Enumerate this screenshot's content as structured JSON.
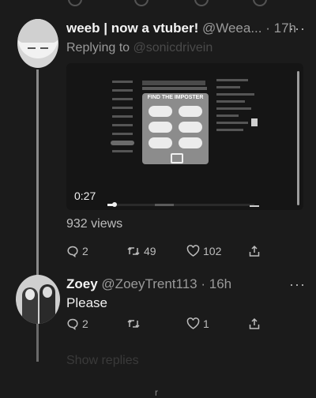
{
  "tweet1": {
    "display_name": "weeb | now a vtuber!",
    "handle": "@Weea...",
    "time": "· 17h",
    "replying_prefix": "Replying to",
    "replying_to": "@sonicdrivein",
    "video": {
      "timestamp": "0:27",
      "progress_fraction": 0.05,
      "card_title": "FIND THE IMPOSTER"
    },
    "views": "932 views",
    "actions": {
      "replies": "2",
      "retweets": "49",
      "likes": "102"
    }
  },
  "tweet2": {
    "display_name": "Zoey",
    "handle": "@ZoeyTrent113",
    "time": "· 16h",
    "text": "Please",
    "actions": {
      "replies": "2",
      "retweets": "",
      "likes": "1"
    }
  },
  "show_replies": "Show replies",
  "more_glyph": "···",
  "icons": [
    "reply-icon",
    "retweet-icon",
    "like-icon",
    "share-icon",
    "more-icon"
  ],
  "colors": {
    "background": "#1b1b1b",
    "text": "#e8e8e8",
    "muted": "#9a9a9a"
  }
}
